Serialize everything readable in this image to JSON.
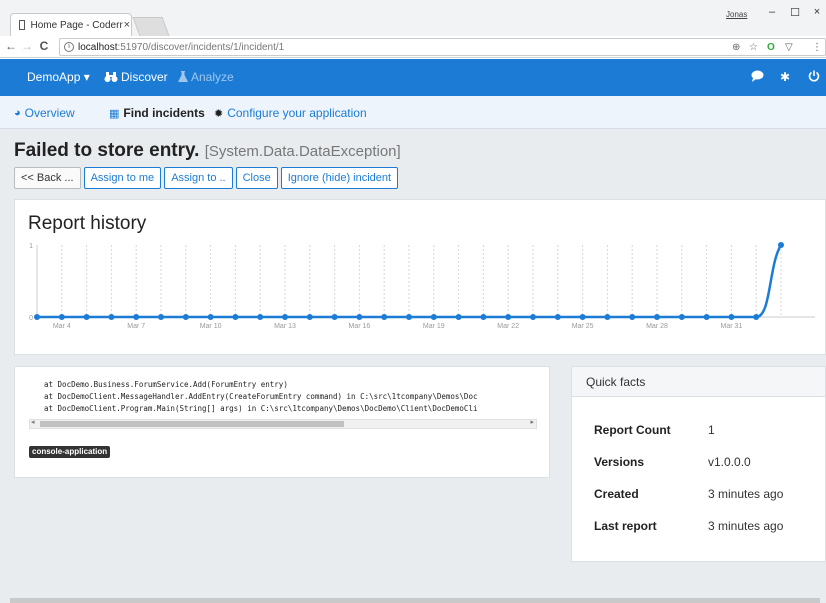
{
  "browser": {
    "tab_title": "Home Page - Coderr",
    "tab_close": "×",
    "user_badge": "Jonas",
    "url_host": "localhost",
    "url_path": ":51970/discover/incidents/1/incident/1",
    "back": "←",
    "forward": "→",
    "reload": "C",
    "minimize": "–",
    "maximize": "☐",
    "close": "×",
    "more": "⋮"
  },
  "navbar": {
    "brand": "DemoApp ▾",
    "discover": "Discover",
    "analyze": "Analyze"
  },
  "subnav": {
    "overview": "Overview",
    "find_incidents": "Find incidents",
    "configure": "Configure your application"
  },
  "incident": {
    "title": "Failed to store entry.",
    "exception": "[System.Data.DataException]"
  },
  "actions": {
    "back": "<< Back ...",
    "assign_me": "Assign to me",
    "assign_to": "Assign to ..",
    "close": "Close",
    "ignore": "Ignore (hide) incident"
  },
  "history": {
    "title": "Report history"
  },
  "chart_data": {
    "type": "line",
    "ylim": [
      0,
      1
    ],
    "y_ticks": [
      "0",
      "1"
    ],
    "x_ticks": [
      "Mar 4",
      "Mar 7",
      "Mar 10",
      "Mar 13",
      "Mar 16",
      "Mar 19",
      "Mar 22",
      "Mar 25",
      "Mar 28",
      "Mar 31"
    ],
    "x": [
      "Mar 3",
      "Mar 4",
      "Mar 5",
      "Mar 6",
      "Mar 7",
      "Mar 8",
      "Mar 9",
      "Mar 10",
      "Mar 11",
      "Mar 12",
      "Mar 13",
      "Mar 14",
      "Mar 15",
      "Mar 16",
      "Mar 17",
      "Mar 18",
      "Mar 19",
      "Mar 20",
      "Mar 21",
      "Mar 22",
      "Mar 23",
      "Mar 24",
      "Mar 25",
      "Mar 26",
      "Mar 27",
      "Mar 28",
      "Mar 29",
      "Mar 30",
      "Mar 31",
      "Apr 1",
      "Apr 2"
    ],
    "values": [
      0,
      0,
      0,
      0,
      0,
      0,
      0,
      0,
      0,
      0,
      0,
      0,
      0,
      0,
      0,
      0,
      0,
      0,
      0,
      0,
      0,
      0,
      0,
      0,
      0,
      0,
      0,
      0,
      0,
      0,
      1
    ],
    "grid": true,
    "color": "#1c7cd5"
  },
  "stacktrace": {
    "lines": [
      "at DocDemo.Business.ForumService.Add(ForumEntry entry)",
      "at DocDemoClient.MessageHandler.AddEntry(CreateForumEntry command) in C:\\src\\1tcompany\\Demos\\Doc",
      "at DocDemoClient.Program.Main(String[] args) in C:\\src\\1tcompany\\Demos\\DocDemo\\Client\\DocDemoCli"
    ],
    "tag": "console-application",
    "scroll_left": "◂",
    "scroll_right": "▸"
  },
  "quick_facts": {
    "title": "Quick facts",
    "rows": [
      {
        "label": "Report Count",
        "value": "1"
      },
      {
        "label": "Versions",
        "value": "v1.0.0.0"
      },
      {
        "label": "Created",
        "value": "3 minutes ago"
      },
      {
        "label": "Last report",
        "value": "3 minutes ago"
      }
    ]
  },
  "icons": {
    "discover": "binoculars-icon",
    "analyze": "flask-icon",
    "overview": "dashboard-icon",
    "find": "table-icon",
    "configure": "gear-icon",
    "chat": "chat-icon",
    "settings": "gear-icon",
    "power": "power-icon"
  }
}
